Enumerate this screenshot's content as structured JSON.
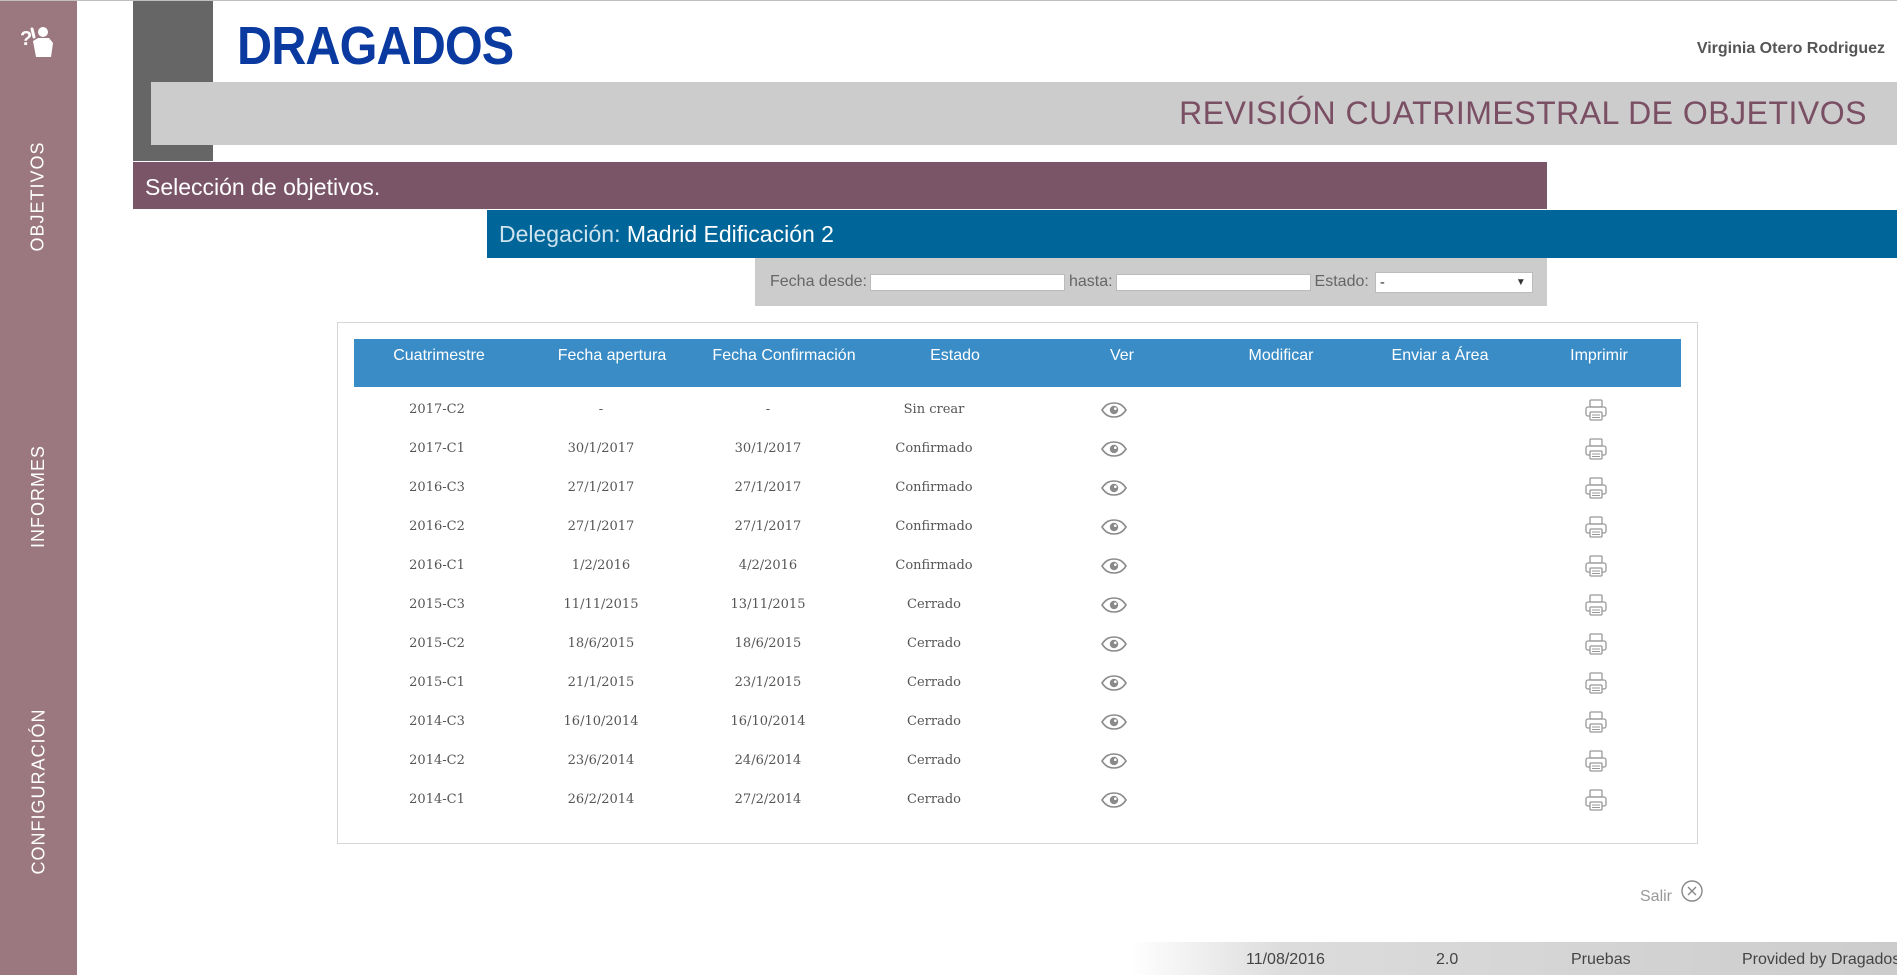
{
  "app": {
    "logo_text": "DRAGADOS",
    "user_name": "Virginia Otero Rodriguez",
    "page_title": "REVISIÓN CUATRIMESTRAL DE OBJETIVOS",
    "colors": {
      "sidebar": "#9b7880",
      "section": "#7a5568",
      "delegation": "#006699",
      "table_header": "#3a8cc6",
      "logo": "#0a3aa0",
      "title": "#7a4e63"
    }
  },
  "sidebar": {
    "help_icon": "help-person-icon",
    "items": [
      {
        "label": "OBJETIVOS"
      },
      {
        "label": "INFORMES"
      },
      {
        "label": "CONFIGURACIÓN"
      }
    ]
  },
  "section": {
    "title": "Selección de objetivos."
  },
  "delegation": {
    "label": "Delegación:",
    "value": "Madrid Edificación 2"
  },
  "filters": {
    "fecha_desde_label": "Fecha desde:",
    "hasta_label": "hasta:",
    "estado_label": "Estado:",
    "estado_value": "-",
    "fecha_desde_value": "",
    "hasta_value": ""
  },
  "table": {
    "columns": [
      "Cuatrimestre",
      "Fecha apertura",
      "Fecha Confirmación",
      "Estado",
      "Ver",
      "Modificar",
      "Enviar a Área",
      "Imprimir"
    ],
    "rows": [
      {
        "cuatrimestre": "2017-C2",
        "apertura": "-",
        "confirmacion": "-",
        "estado": "Sin crear"
      },
      {
        "cuatrimestre": "2017-C1",
        "apertura": "30/1/2017",
        "confirmacion": "30/1/2017",
        "estado": "Confirmado"
      },
      {
        "cuatrimestre": "2016-C3",
        "apertura": "27/1/2017",
        "confirmacion": "27/1/2017",
        "estado": "Confirmado"
      },
      {
        "cuatrimestre": "2016-C2",
        "apertura": "27/1/2017",
        "confirmacion": "27/1/2017",
        "estado": "Confirmado"
      },
      {
        "cuatrimestre": "2016-C1",
        "apertura": "1/2/2016",
        "confirmacion": "4/2/2016",
        "estado": "Confirmado"
      },
      {
        "cuatrimestre": "2015-C3",
        "apertura": "11/11/2015",
        "confirmacion": "13/11/2015",
        "estado": "Cerrado"
      },
      {
        "cuatrimestre": "2015-C2",
        "apertura": "18/6/2015",
        "confirmacion": "18/6/2015",
        "estado": "Cerrado"
      },
      {
        "cuatrimestre": "2015-C1",
        "apertura": "21/1/2015",
        "confirmacion": "23/1/2015",
        "estado": "Cerrado"
      },
      {
        "cuatrimestre": "2014-C3",
        "apertura": "16/10/2014",
        "confirmacion": "16/10/2014",
        "estado": "Cerrado"
      },
      {
        "cuatrimestre": "2014-C2",
        "apertura": "23/6/2014",
        "confirmacion": "24/6/2014",
        "estado": "Cerrado"
      },
      {
        "cuatrimestre": "2014-C1",
        "apertura": "26/2/2014",
        "confirmacion": "27/2/2014",
        "estado": "Cerrado"
      }
    ],
    "ver_icon": "eye-icon",
    "imprimir_icon": "printer-icon"
  },
  "salir": {
    "label": "Salir",
    "icon": "close-circle-icon"
  },
  "footer": {
    "date": "11/08/2016",
    "version": "2.0",
    "environment": "Pruebas",
    "provider": "Provided by Dragados"
  }
}
